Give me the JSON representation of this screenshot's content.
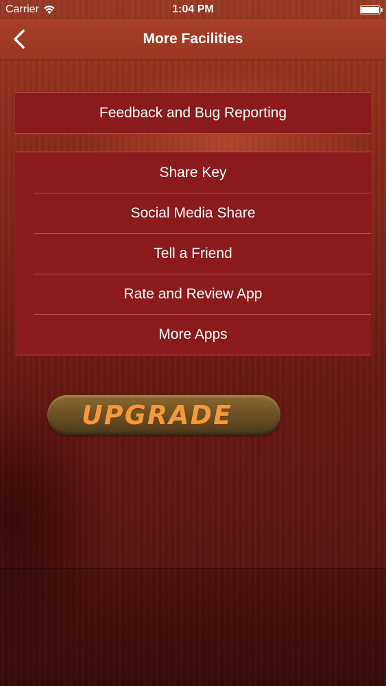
{
  "status_bar": {
    "carrier": "Carrier",
    "time": "1:04 PM",
    "wifi_icon": "wifi-icon",
    "battery_icon": "battery-icon"
  },
  "nav": {
    "title": "More Facilities",
    "back_icon": "chevron-left-icon"
  },
  "menu": {
    "group1": [
      {
        "label": "Feedback and Bug Reporting"
      }
    ],
    "group2": [
      {
        "label": "Share Key"
      },
      {
        "label": "Social Media Share"
      },
      {
        "label": "Tell a Friend"
      },
      {
        "label": "Rate and Review App"
      },
      {
        "label": "More Apps"
      }
    ]
  },
  "upgrade": {
    "label": "UPGRADE"
  },
  "colors": {
    "nav_bar": "#a8402a",
    "menu_cell": "#8b1a1d",
    "upgrade_text": "#f39a3c"
  }
}
